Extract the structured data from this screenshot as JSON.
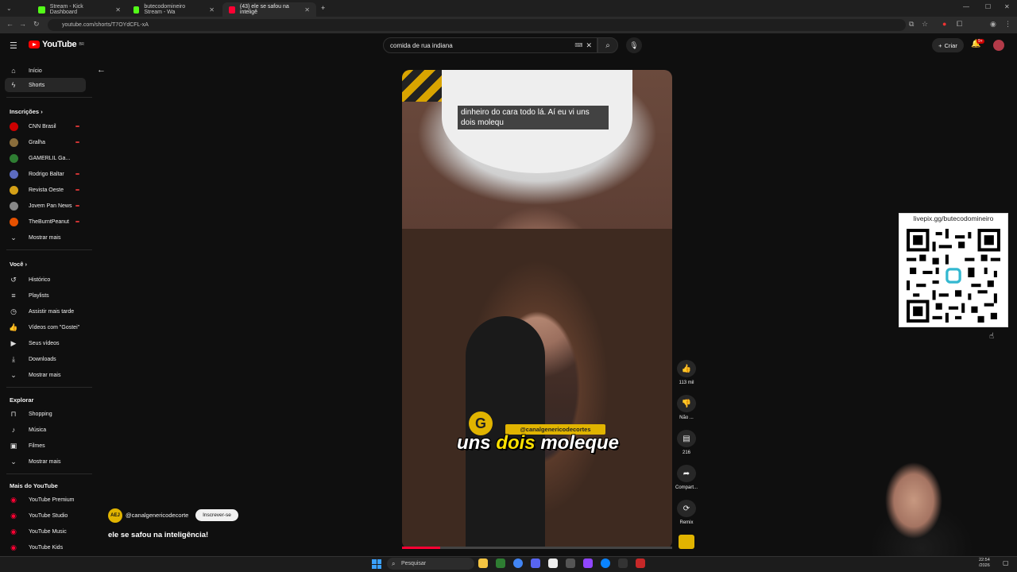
{
  "browser": {
    "tabs": [
      {
        "label": "Stream - Kick Dashboard",
        "favicon_color": "#53fc18"
      },
      {
        "label": "butecodomineiro Stream - Wa",
        "favicon_color": "#53fc18"
      },
      {
        "label": "(43) ele se safou na inteligê",
        "favicon_color": "#ff0033"
      }
    ],
    "url": "youtube.com/shorts/T7OYdCFL-xA"
  },
  "header": {
    "logo_text": "YouTube",
    "logo_region": "BR",
    "search_value": "comida de rua indiana",
    "create_label": "Criar",
    "notification_count": "9+"
  },
  "sidebar": {
    "main": [
      {
        "label": "Início",
        "icon": "home-icon"
      },
      {
        "label": "Shorts",
        "icon": "shorts-icon",
        "active": true
      }
    ],
    "subscriptions_heading": "Inscrições",
    "subscriptions": [
      {
        "label": "CNN Brasil",
        "color": "#cc0000"
      },
      {
        "label": "Gralha",
        "color": "#8a6d3b"
      },
      {
        "label": "GAMERLIL Ga...",
        "color": "#2e7d32"
      },
      {
        "label": "Rodrigo Baltar",
        "color": "#5c6bc0"
      },
      {
        "label": "Revista Oeste",
        "color": "#d4a017"
      },
      {
        "label": "Jovem Pan News",
        "color": "#888888"
      },
      {
        "label": "TheBurntPeanut",
        "color": "#e65100"
      }
    ],
    "subscriptions_more": "Mostrar mais",
    "you_heading": "Você",
    "you": [
      {
        "label": "Histórico",
        "icon": "history-icon"
      },
      {
        "label": "Playlists",
        "icon": "playlist-icon"
      },
      {
        "label": "Assistir mais tarde",
        "icon": "clock-icon"
      },
      {
        "label": "Vídeos com \"Gostei\"",
        "icon": "thumbs-up-icon"
      },
      {
        "label": "Seus vídeos",
        "icon": "video-icon"
      },
      {
        "label": "Downloads",
        "icon": "download-icon"
      },
      {
        "label": "Mostrar mais",
        "icon": "chevron-down-icon"
      }
    ],
    "explore_heading": "Explorar",
    "explore": [
      {
        "label": "Shopping",
        "icon": "bag-icon"
      },
      {
        "label": "Música",
        "icon": "music-icon"
      },
      {
        "label": "Filmes",
        "icon": "film-icon"
      },
      {
        "label": "Mostrar mais",
        "icon": "chevron-down-icon"
      }
    ],
    "more_heading": "Mais do YouTube",
    "more": [
      {
        "label": "YouTube Premium"
      },
      {
        "label": "YouTube Studio"
      },
      {
        "label": "YouTube Music"
      },
      {
        "label": "YouTube Kids"
      }
    ]
  },
  "video": {
    "caption_box": "dinheiro do cara todo lá. Aí eu vi uns dois molequ",
    "overlay_handle": "@canalgenericodecortes",
    "overlay_badge": "G",
    "big_caption_a": "uns ",
    "big_caption_hl": "dois",
    "big_caption_b": " moleque",
    "progress_fraction": 0.14
  },
  "channel": {
    "avatar_text": "AEJ",
    "handle": "@canalgenericodecorte",
    "subscribe_label": "Inscrever-se",
    "title": "ele se safou na inteligência!"
  },
  "actions": {
    "like_count": "113 mil",
    "dislike_label": "Não ...",
    "comment_count": "216",
    "share_label": "Compart...",
    "remix_label": "Remix"
  },
  "qr_overlay": {
    "url": "livepix.gg/butecodomineiro"
  },
  "taskbar": {
    "search_placeholder": "Pesquisar",
    "time": "22:54",
    "date": "/2026"
  }
}
